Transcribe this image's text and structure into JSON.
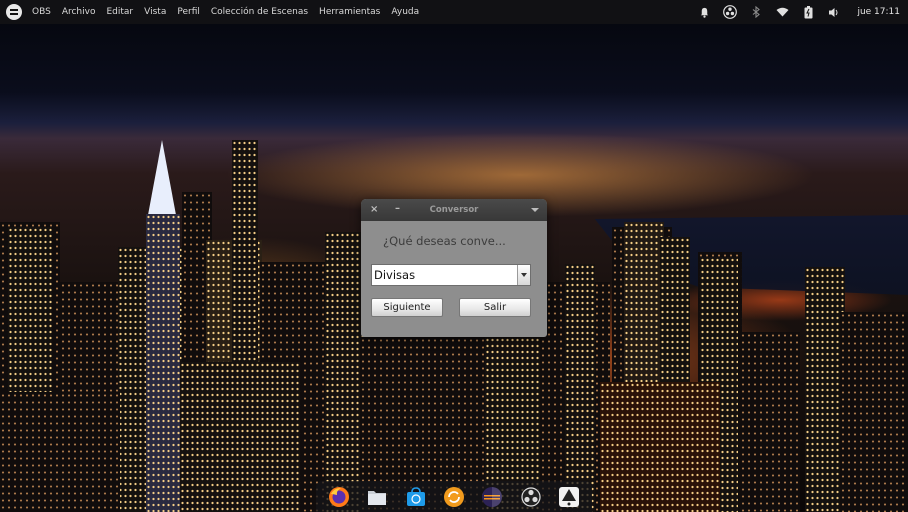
{
  "top_panel": {
    "menu": [
      "OBS",
      "Archivo",
      "Editar",
      "Vista",
      "Perfil",
      "Colección de Escenas",
      "Herramientas",
      "Ayuda"
    ],
    "tray_icons": [
      "notification-bell-icon",
      "obs-studio-icon",
      "bluetooth-icon",
      "wifi-icon",
      "battery-icon",
      "volume-icon"
    ],
    "clock": "jue 17:11"
  },
  "window": {
    "title": "Conversor",
    "close_glyph": "×",
    "minimize_glyph": "–",
    "question": "¿Qué deseas conve...",
    "combo_value": "Divisas",
    "next_label": "Siguiente",
    "exit_label": "Salir"
  },
  "dock": {
    "apps": [
      {
        "name": "firefox-icon",
        "active": false
      },
      {
        "name": "files-icon",
        "active": false
      },
      {
        "name": "software-store-icon",
        "active": false
      },
      {
        "name": "software-updater-icon",
        "active": false
      },
      {
        "name": "eclipse-icon",
        "active": false
      },
      {
        "name": "obs-studio-icon",
        "active": true
      },
      {
        "name": "inkscape-icon",
        "active": false
      }
    ]
  }
}
